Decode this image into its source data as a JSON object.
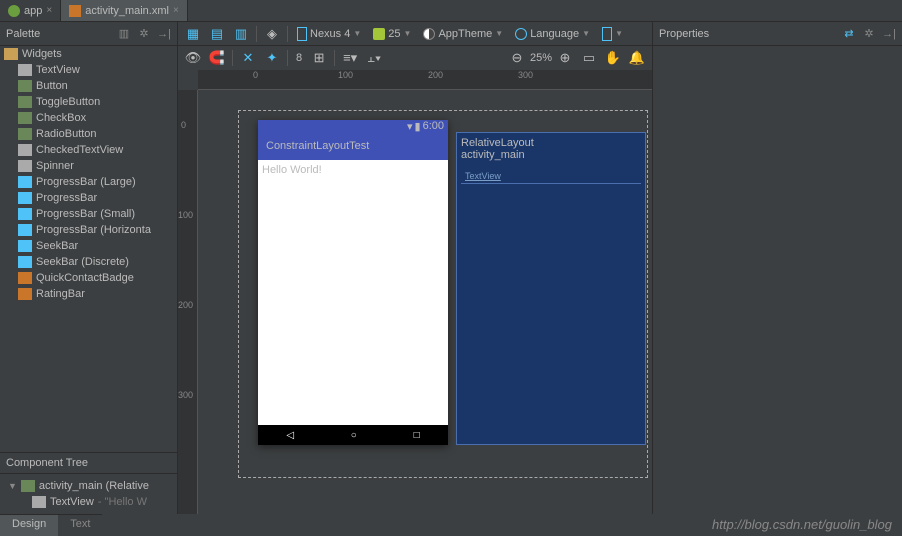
{
  "tabs": [
    {
      "label": "app",
      "active": false
    },
    {
      "label": "activity_main.xml",
      "active": true
    }
  ],
  "palette": {
    "title": "Palette",
    "group": "Widgets",
    "items": [
      "TextView",
      "Button",
      "ToggleButton",
      "CheckBox",
      "RadioButton",
      "CheckedTextView",
      "Spinner",
      "ProgressBar (Large)",
      "ProgressBar",
      "ProgressBar (Small)",
      "ProgressBar (Horizonta",
      "SeekBar",
      "SeekBar (Discrete)",
      "QuickContactBadge",
      "RatingBar"
    ]
  },
  "componentTree": {
    "title": "Component Tree",
    "root": "activity_main (Relative",
    "child": "TextView",
    "childSuffix": " - \"Hello W"
  },
  "toolbar": {
    "device": "Nexus 4",
    "api": "25",
    "theme": "AppTheme",
    "language": "Language"
  },
  "designToolbar": {
    "num": "8",
    "zoom": "25%"
  },
  "ruler": {
    "t0": "0",
    "t100": "100",
    "t200": "200",
    "t300": "300"
  },
  "preview": {
    "time": "6:00",
    "appTitle": "ConstraintLayoutTest",
    "content": "Hello World!"
  },
  "blueprint": {
    "root": "RelativeLayout",
    "id": "activity_main",
    "child": "TextView"
  },
  "properties": {
    "title": "Properties"
  },
  "bottomTabs": [
    "Design",
    "Text"
  ],
  "watermark": "http://blog.csdn.net/guolin_blog"
}
